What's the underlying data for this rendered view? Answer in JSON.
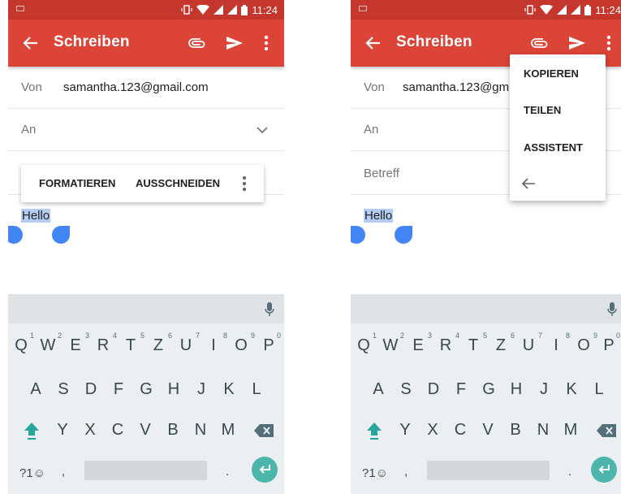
{
  "status": {
    "time": "11:24"
  },
  "compose": {
    "title": "Schreiben",
    "from_label": "Von",
    "from_value": "samantha.123@gmail.com",
    "from_value_truncated": "samantha.123@gm",
    "to_label": "An",
    "subject_placeholder": "Betreff",
    "body_text": "Hello"
  },
  "selection_toolbar": {
    "format_label": "FORMATIEREN",
    "cut_label": "AUSSCHNEIDEN"
  },
  "overflow_menu": {
    "items": [
      "KOPIEREN",
      "TEILEN",
      "ASSISTENT"
    ]
  },
  "keyboard": {
    "row1": [
      "Q",
      "W",
      "E",
      "R",
      "T",
      "Z",
      "U",
      "I",
      "O",
      "P"
    ],
    "row1_hints": [
      "1",
      "2",
      "3",
      "4",
      "5",
      "6",
      "7",
      "8",
      "9",
      "0"
    ],
    "row2": [
      "A",
      "S",
      "D",
      "F",
      "G",
      "H",
      "J",
      "K",
      "L"
    ],
    "row3": [
      "Y",
      "X",
      "C",
      "V",
      "B",
      "N",
      "M"
    ],
    "symbols_label": "?1☺",
    "comma": ",",
    "period": "."
  },
  "colors": {
    "appbar": "#db4437",
    "statusbar": "#c5372c",
    "selection": "#b3cdf3",
    "handle": "#4285f4",
    "enter": "#4db6ac",
    "shift": "#26a69a"
  }
}
